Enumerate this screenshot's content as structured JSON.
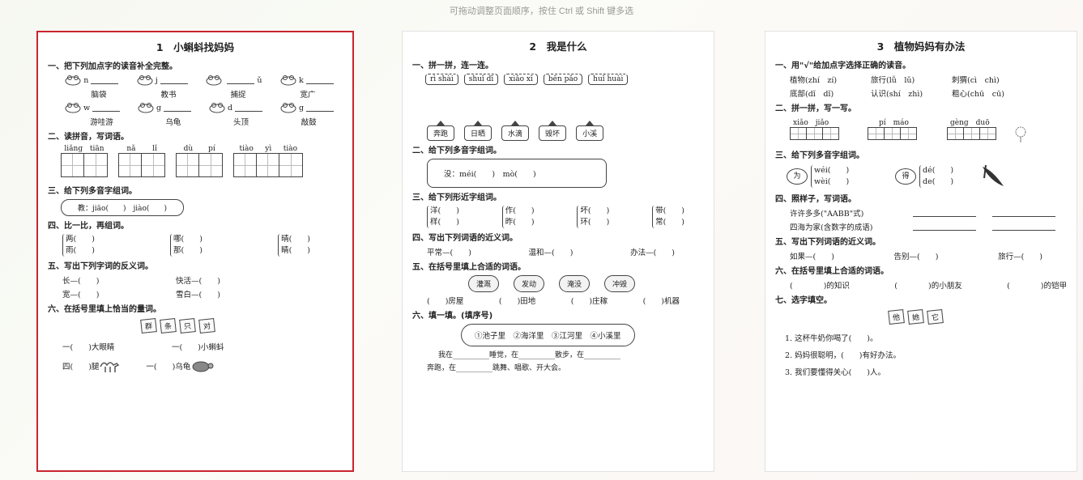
{
  "hint": "可拖动调整页面顺序，按住 Ctrl 或 Shift 键多选",
  "pages": [
    {
      "title": "1　小蝌蚪找妈妈",
      "s1": "一、把下列加点字的读音补全完整。",
      "s1_row1": [
        "n",
        "j",
        "ǔ",
        "k"
      ],
      "s1_words1": [
        "脑袋",
        "教书",
        "捕捉",
        "宽广"
      ],
      "s1_row2": [
        "w",
        "g",
        "d",
        "g"
      ],
      "s1_words2": [
        "游哇游",
        "乌龟",
        "头顶",
        "敲鼓"
      ],
      "s2": "二、读拼音，写词语。",
      "s2_py": [
        [
          "liǎng",
          "tiān"
        ],
        [
          "nǎ",
          "lǐ"
        ],
        [
          "dù",
          "pí"
        ],
        [
          "tiào",
          "yì",
          "tiào"
        ]
      ],
      "s3": "三、给下列多音字组词。",
      "s3_body": "教：jiāo(　　)　jiào(　　)",
      "s4": "四、比一比，再组词。",
      "s4_a": [
        "两(　　)",
        "雨(　　)"
      ],
      "s4_b": [
        "哪(　　)",
        "那(　　)"
      ],
      "s4_c": [
        "晴(　　)",
        "睛(　　)"
      ],
      "s5": "五、写出下列字词的反义词。",
      "s5_r1": [
        "长—(　　)",
        "快活—(　　)"
      ],
      "s5_r2": [
        "宽—(　　)",
        "雪白—(　　)"
      ],
      "s6": "六、在括号里填上恰当的量词。",
      "s6_flags": [
        "群",
        "条",
        "只",
        "对"
      ],
      "s6_r1": [
        "一(　　)大眼睛",
        "一(　　)小蝌蚪"
      ],
      "s6_r2": [
        "四(　　)腿",
        "一(　　)乌龟"
      ]
    },
    {
      "title": "2　我是什么",
      "s1": "一、拼一拼，连一连。",
      "s1_py": [
        "rì shài",
        "shuǐ dī",
        "xiǎo xī",
        "bēn pǎo",
        "huǐ huài"
      ],
      "s1_words": [
        "奔跑",
        "日晒",
        "水滴",
        "毁坏",
        "小溪"
      ],
      "s2": "二、给下列多音字组词。",
      "s2_body": "没：méi(　　)　mò(　　)",
      "s3": "三、给下列形近字组词。",
      "s3_pairs": [
        [
          "洋(　　)",
          "样(　　)"
        ],
        [
          "作(　　)",
          "昨(　　)"
        ],
        [
          "坏(　　)",
          "环(　　)"
        ],
        [
          "带(　　)",
          "常(　　)"
        ]
      ],
      "s4": "四、写出下列词语的近义词。",
      "s4_body": [
        "平常—(　　)",
        "温和—(　　)",
        "办法—(　　)"
      ],
      "s5": "五、在括号里填上合适的词语。",
      "s5_clouds": [
        "灌溉",
        "发动",
        "淹没",
        "冲毁"
      ],
      "s5_body": [
        "(　　)房屋",
        "(　　)田地",
        "(　　)庄稼",
        "(　　)机器"
      ],
      "s6": "六、填一填。(填序号)",
      "s6_box": "①池子里　②海洋里　③江河里　④小溪里",
      "s6_l1": "我在__________睡觉，在__________散步，在__________",
      "s6_l2": "奔跑，在__________跳舞、唱歌、开大会。"
    },
    {
      "title": "3　植物妈妈有办法",
      "s1": "一、用\"√\"给加点字选择正确的读音。",
      "s1_r1": [
        "植物(zhí　zí)",
        "旅行(lǚ　lǔ)",
        "刺猬(cì　chì)"
      ],
      "s1_r2": [
        "底部(dǐ　dǐ)",
        "认识(shí　zhì)",
        "粗心(chū　cū)"
      ],
      "s2": "二、拼一拼，写一写。",
      "s2_py": [
        "xiǎo　jiǎo",
        "pí　máo",
        "gèng　duō"
      ],
      "s3": "三、给下列多音字组词。",
      "s3_a": [
        "wéi(　　)",
        "wèi(　　)"
      ],
      "s3_a_char": "为",
      "s3_b": [
        "dé(　　)",
        "de(　　)"
      ],
      "s3_b_char": "得",
      "s4": "四、照样子，写词语。",
      "s4_r1": "许许多多(\"AABB\"式)",
      "s4_r2": "四海为家(含数字的成语)",
      "s5": "五、写出下列词语的近义词。",
      "s5_body": [
        "如果—(　　)",
        "告别—(　　)",
        "旅行—(　　)"
      ],
      "s6": "六、在括号里填上合适的词语。",
      "s6_body": [
        "(　　　　)的知识",
        "(　　　　)的小朋友",
        "(　　　　)的铠甲"
      ],
      "s7": "七、选字填空。",
      "s7_flags": [
        "他",
        "她",
        "它"
      ],
      "s7_q": [
        "1. 这杯牛奶你喝了(　　)。",
        "2. 妈妈很聪明，(　　)有好办法。",
        "3. 我们要懂得关心(　　)人。"
      ]
    }
  ]
}
